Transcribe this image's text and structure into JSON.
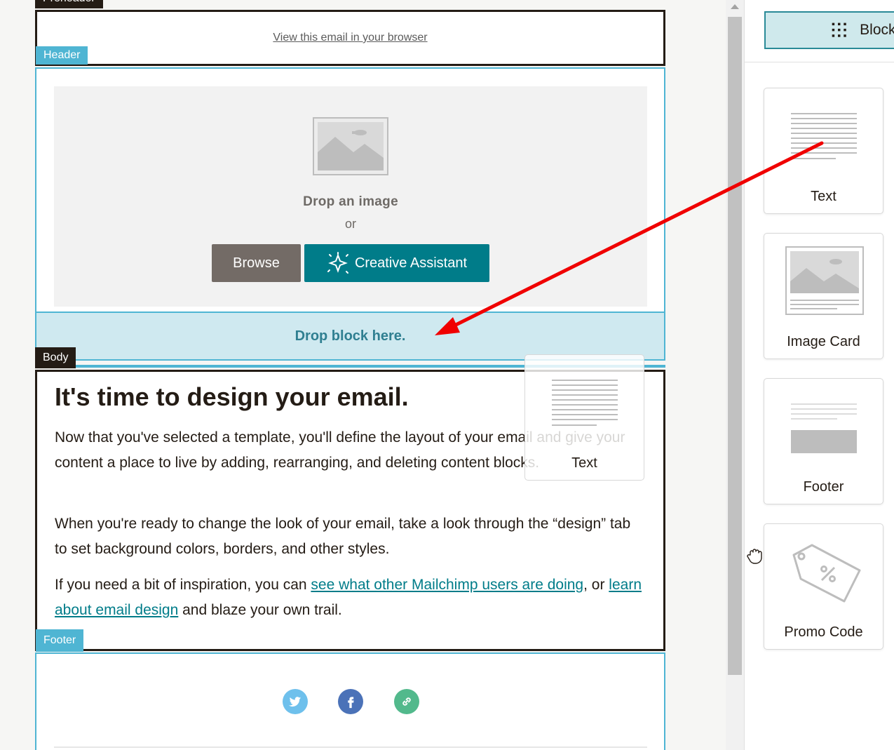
{
  "canvas": {
    "preheader": {
      "tag": "Preheader",
      "link": "View this email in your browser"
    },
    "header": {
      "tag": "Header",
      "drop_image": "Drop an image",
      "or": "or",
      "browse": "Browse",
      "creative_assistant": "Creative Assistant"
    },
    "drop_zone": "Drop block here.",
    "body": {
      "tag": "Body",
      "heading": "It's time to design your email.",
      "p1": "Now that you've selected a template, you'll define the layout of your email and give your content a place to live by adding, rearranging, and deleting content blocks.",
      "p2": "When you're ready to change the look of your email, take a look through the “design” tab to set background colors, borders, and other styles.",
      "p3_start": "If you need a bit of inspiration, you can ",
      "p3_link1": "see what other Mailchimp users are doing",
      "p3_mid": ", or ",
      "p3_link2": "learn about email design",
      "p3_end": " and blaze your own trail."
    },
    "footer": {
      "tag": "Footer",
      "social_icons": [
        "twitter-icon",
        "facebook-icon",
        "link-icon"
      ]
    }
  },
  "panel": {
    "tab_label": "Blocks",
    "cards": [
      {
        "label": "Text",
        "icon": "text-block-icon"
      },
      {
        "label": "Image Card",
        "icon": "image-card-icon"
      },
      {
        "label": "Footer",
        "icon": "footer-block-icon"
      },
      {
        "label": "Promo Code",
        "icon": "promo-code-icon"
      }
    ]
  },
  "drag_ghost": {
    "label": "Text"
  },
  "colors": {
    "accent": "#007c89",
    "section_blue": "#4fb5d3",
    "dark": "#241c15",
    "drop_zone_bg": "#cfe9f0",
    "annotation_arrow": "#f00000"
  }
}
